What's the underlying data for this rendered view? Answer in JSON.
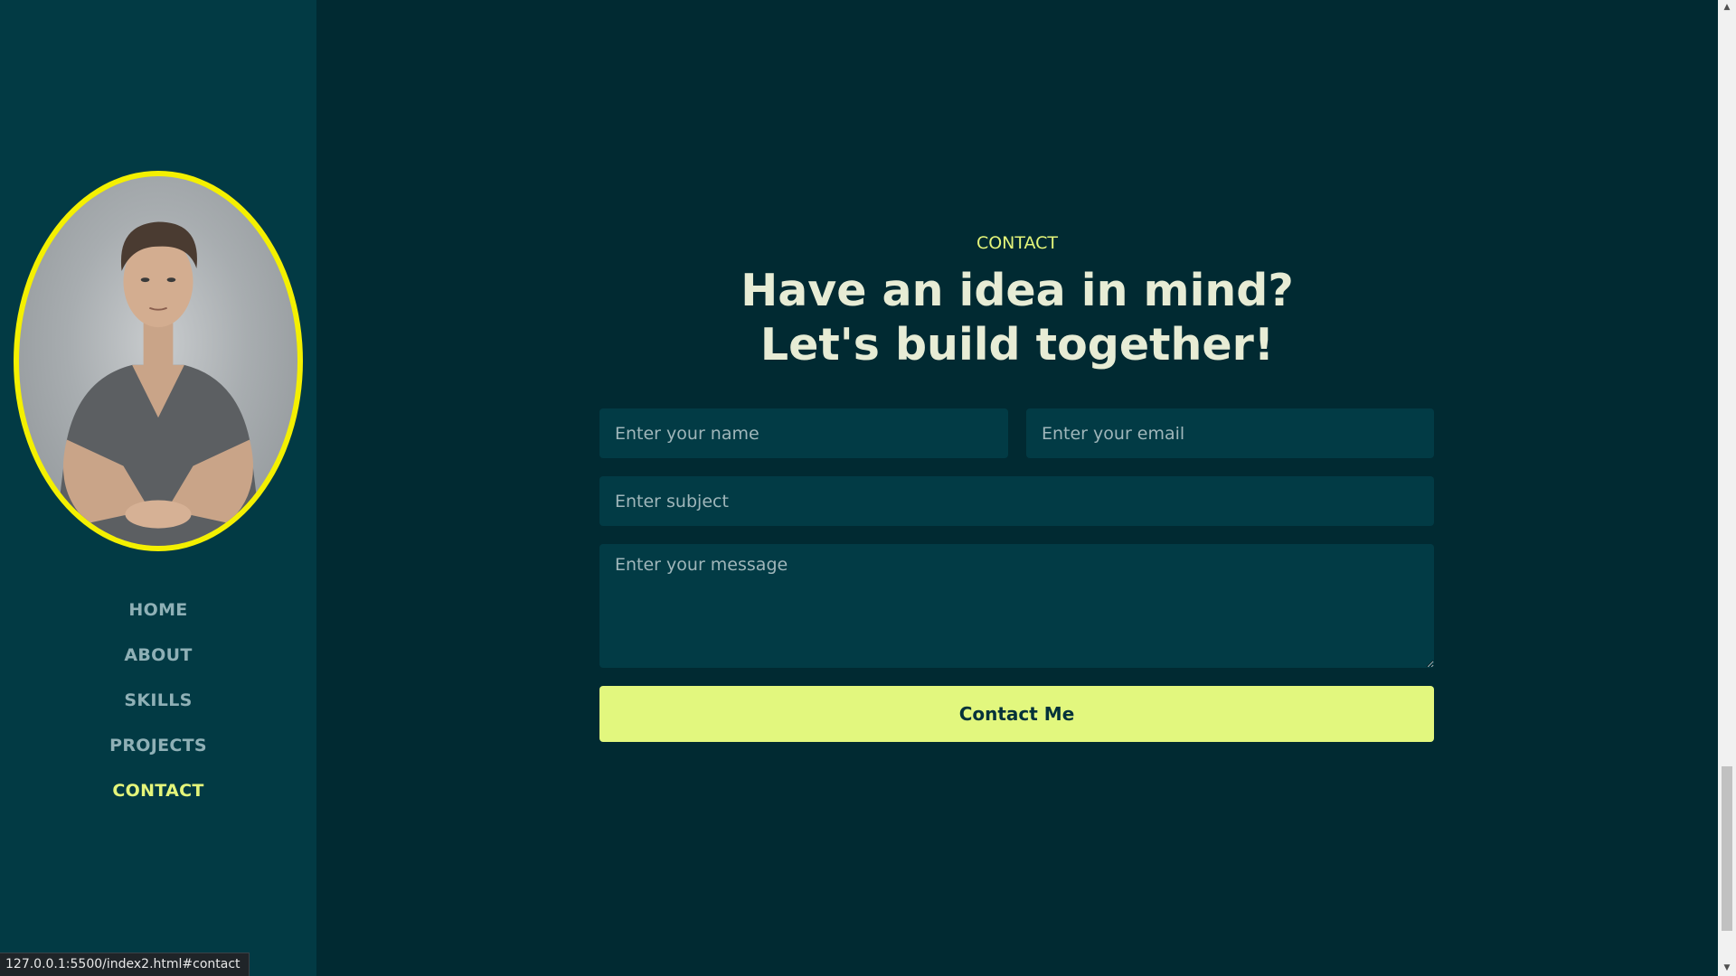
{
  "sidebar": {
    "nav": [
      {
        "label": "HOME",
        "active": false
      },
      {
        "label": "ABOUT",
        "active": false
      },
      {
        "label": "SKILLS",
        "active": false
      },
      {
        "label": "PROJECTS",
        "active": false
      },
      {
        "label": "CONTACT",
        "active": true
      }
    ]
  },
  "contact": {
    "label": "CONTACT",
    "headline_line1": "Have an idea in mind?",
    "headline_line2": "Let's build together!",
    "name_placeholder": "Enter your name",
    "email_placeholder": "Enter your email",
    "subject_placeholder": "Enter subject",
    "message_placeholder": "Enter your message",
    "submit_label": "Contact Me"
  },
  "status_bar": {
    "url": "127.0.0.1:5500/index2.html#contact"
  },
  "colors": {
    "sidebar_bg": "#023a44",
    "main_bg": "#012a32",
    "accent": "#e2f77e",
    "avatar_border": "#f4f000",
    "field_bg": "#023b45",
    "headline": "#e7ecd5"
  },
  "icons": {
    "scroll_up": "triangle-up-icon",
    "scroll_down": "triangle-down-icon"
  }
}
